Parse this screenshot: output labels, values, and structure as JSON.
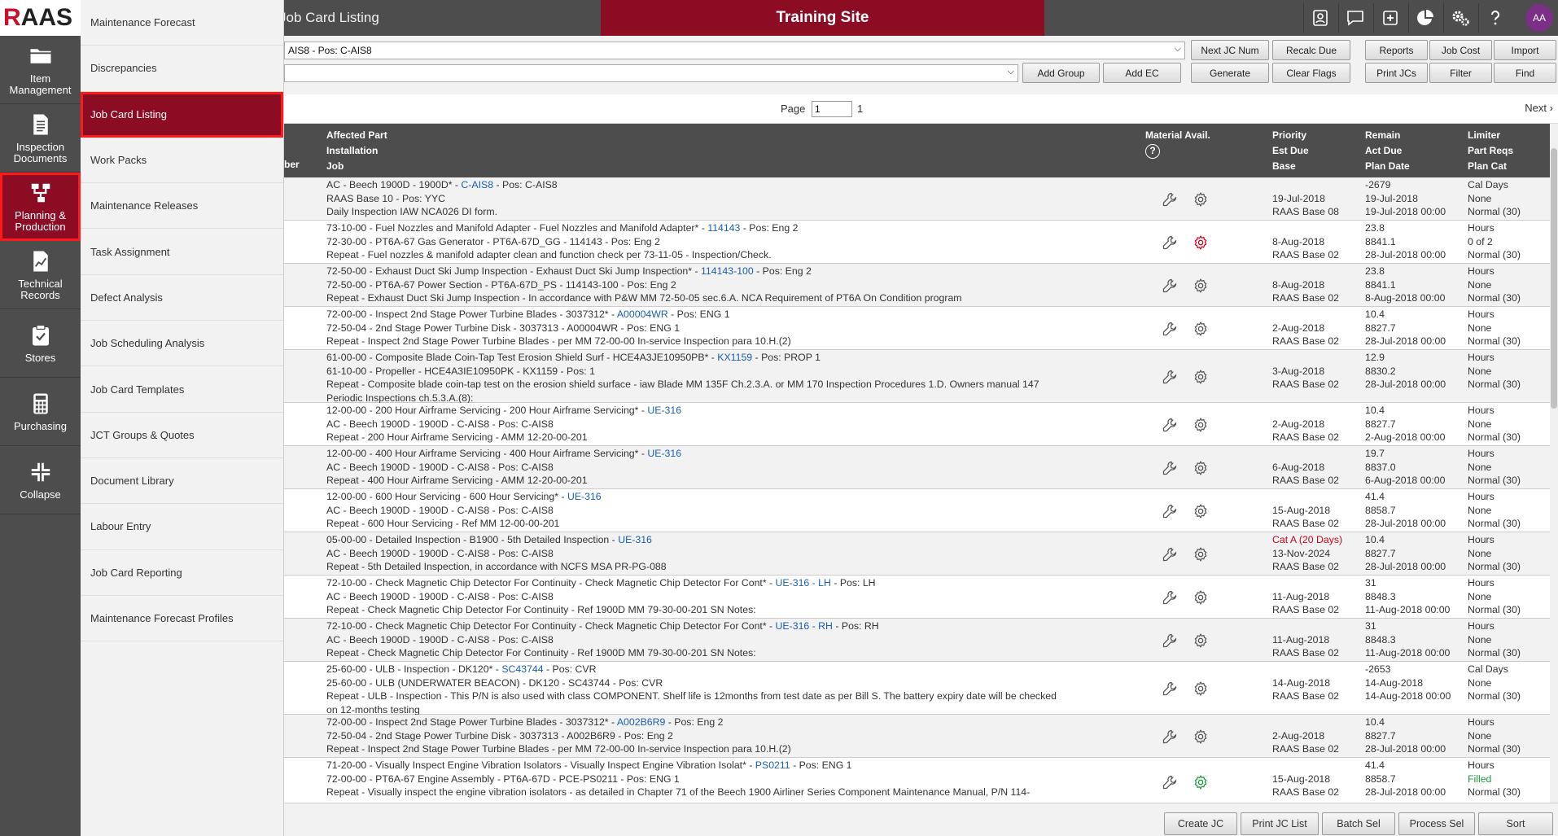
{
  "logo": {
    "text_r": "R",
    "text_rest": "AAS"
  },
  "rail": [
    {
      "label": "Item Management",
      "icon": "folder-icon"
    },
    {
      "label": "Inspection Documents",
      "icon": "document-icon"
    },
    {
      "label": "Planning & Production",
      "icon": "flow-icon",
      "active": true
    },
    {
      "label": "Technical Records",
      "icon": "chart-document-icon"
    },
    {
      "label": "Stores",
      "icon": "clipboard-check-icon"
    },
    {
      "label": "Purchasing",
      "icon": "calculator-icon"
    },
    {
      "label": "Collapse",
      "icon": "collapse-icon"
    }
  ],
  "menu": [
    {
      "label": "Maintenance Forecast"
    },
    {
      "label": "Discrepancies"
    },
    {
      "label": "Job Card Listing",
      "active": true
    },
    {
      "label": "Work Packs"
    },
    {
      "label": "Maintenance Releases"
    },
    {
      "label": "Task Assignment"
    },
    {
      "label": "Defect Analysis"
    },
    {
      "label": "Job Scheduling Analysis"
    },
    {
      "label": "Job Card Templates"
    },
    {
      "label": "JCT Groups & Quotes"
    },
    {
      "label": "Document Library"
    },
    {
      "label": "Labour Entry"
    },
    {
      "label": "Job Card Reporting"
    },
    {
      "label": "Maintenance Forecast Profiles"
    }
  ],
  "header": {
    "title": "Job Card Listing",
    "site_banner": "Training Site",
    "avatar": "AA",
    "icons": [
      "id-card-icon",
      "chat-icon",
      "plus-square-icon",
      "pie-chart-icon",
      "gears-icon",
      "help-icon"
    ]
  },
  "toolbar": {
    "aircraft_select": "AIS8 - Pos: C-AIS8",
    "group_select": "",
    "buttons": {
      "next_jc_num": "Next JC Num",
      "recalc_due": "Recalc Due",
      "reports": "Reports",
      "job_cost": "Job Cost",
      "import": "Import",
      "add_group": "Add Group",
      "add_ec": "Add EC",
      "generate": "Generate",
      "clear_flags": "Clear Flags",
      "print_jcs": "Print JCs",
      "filter": "Filter",
      "find": "Find"
    }
  },
  "pager": {
    "label": "Page",
    "value": "1",
    "total": "1",
    "next": "Next"
  },
  "columns": {
    "number_fragment": "ber",
    "desc": [
      "Affected Part",
      "Installation",
      "Job"
    ],
    "material": "Material Avail.",
    "priority": [
      "Priority",
      "Est Due",
      "Base"
    ],
    "remain": [
      "Remain",
      "Act Due",
      "Plan Date"
    ],
    "limiter": [
      "Limiter",
      "Part Reqs",
      "Plan Cat"
    ]
  },
  "rows": [
    {
      "l1": "AC - Beech 1900D - 1900D* - ",
      "l1_link": "C-AIS8",
      "l1_tail": " - Pos: C-AIS8",
      "l2": "RAAS Base 10 - Pos: YYC",
      "l3": "Daily Inspection IAW NCA026 DI form.",
      "l4": "",
      "gear": "normal",
      "p1": "",
      "p2": "19-Jul-2018",
      "p3": "RAAS Base 08",
      "r1": "-2679",
      "r2": "19-Jul-2018",
      "r3": "19-Jul-2018 00:00",
      "m1": "Cal Days",
      "m2": "None",
      "m3": "Normal (30)"
    },
    {
      "l1": "73-10-00 - Fuel Nozzles and Manifold Adapter - Fuel Nozzles and Manifold Adapter* - ",
      "l1_link": "114143",
      "l1_tail": " - Pos: Eng 2",
      "l2": "72-30-00 - PT6A-67 Gas Generator - PT6A-67D_GG - 114143 - Pos: Eng 2",
      "l3": "Repeat - Fuel nozzles & manifold adapter clean and function check per 73-11-05 - Inspection/Check.",
      "l4": "",
      "gear": "red",
      "p1": "",
      "p2": "8-Aug-2018",
      "p3": "RAAS Base 02",
      "r1": "23.8",
      "r2": "8841.1",
      "r3": "28-Jul-2018 00:00",
      "m1": "Hours",
      "m2": "0 of 2",
      "m3": "Normal (30)"
    },
    {
      "l1": "72-50-00 - Exhaust Duct Ski Jump Inspection - Exhaust Duct Ski Jump Inspection* - ",
      "l1_link": "114143-100",
      "l1_tail": " - Pos: Eng 2",
      "l2": "72-50-00 - PT6A-67 Power Section - PT6A-67D_PS - 114143-100 - Pos: Eng 2",
      "l3": "Repeat - Exhaust Duct Ski Jump Inspection - In accordance with P&W MM 72-50-05 sec.6.A. NCA Requirement of PT6A On Condition program",
      "l4": "",
      "gear": "normal",
      "p1": "",
      "p2": "8-Aug-2018",
      "p3": "RAAS Base 02",
      "r1": "23.8",
      "r2": "8841.1",
      "r3": "8-Aug-2018 00:00",
      "m1": "Hours",
      "m2": "None",
      "m3": "Normal (30)"
    },
    {
      "l1": "72-00-00 - Inspect 2nd Stage Power Turbine Blades - 3037312* - ",
      "l1_link": "A00004WR",
      "l1_tail": " - Pos: ENG 1",
      "l2": "72-50-04 - 2nd Stage Power Turbine Disk - 3037313 - A00004WR - Pos: ENG 1",
      "l3": "Repeat - Inspect 2nd Stage Power Turbine Blades - per MM 72-00-00 In-service Inspection para 10.H.(2)",
      "l4": "",
      "gear": "normal",
      "p1": "",
      "p2": "2-Aug-2018",
      "p3": "RAAS Base 02",
      "r1": "10.4",
      "r2": "8827.7",
      "r3": "28-Jul-2018 00:00",
      "m1": "Hours",
      "m2": "None",
      "m3": "Normal (30)"
    },
    {
      "l1": "61-00-00 - Composite Blade Coin-Tap Test Erosion Shield Surf - HCE4A3JE10950PB* - ",
      "l1_link": "KX1159",
      "l1_tail": " - Pos: PROP 1",
      "l2": "61-10-00 - Propeller - HCE4A3IE10950PK - KX1159 - Pos: 1",
      "l3": "Repeat - Composite blade coin-tap test on the erosion shield surface - iaw Blade MM 135F Ch.2.3.A. or MM 170 Inspection Procedures 1.D. Owners manual 147",
      "l4": "Periodic Inspections ch.5.3.A.(8):",
      "gear": "normal",
      "p1": "",
      "p2": "3-Aug-2018",
      "p3": "RAAS Base 02",
      "r1": "12.9",
      "r2": "8830.2",
      "r3": "28-Jul-2018 00:00",
      "m1": "Hours",
      "m2": "None",
      "m3": "Normal (30)"
    },
    {
      "l1": "12-00-00 - 200 Hour Airframe Servicing - 200 Hour Airframe Servicing* - ",
      "l1_link": "UE-316",
      "l1_tail": "",
      "l2": "AC - Beech 1900D - 1900D - C-AIS8 - Pos: C-AIS8",
      "l3": "Repeat - 200 Hour Airframe Servicing - AMM 12-20-00-201",
      "l4": "",
      "gear": "normal",
      "p1": "",
      "p2": "2-Aug-2018",
      "p3": "RAAS Base 02",
      "r1": "10.4",
      "r2": "8827.7",
      "r3": "2-Aug-2018 00:00",
      "m1": "Hours",
      "m2": "None",
      "m3": "Normal (30)"
    },
    {
      "l1": "12-00-00 - 400 Hour Airframe Servicing - 400 Hour Airframe Servicing* - ",
      "l1_link": "UE-316",
      "l1_tail": "",
      "l2": "AC - Beech 1900D - 1900D - C-AIS8 - Pos: C-AIS8",
      "l3": "Repeat - 400 Hour Airframe Servicing - AMM 12-20-00-201",
      "l4": "",
      "gear": "normal",
      "p1": "",
      "p2": "6-Aug-2018",
      "p3": "RAAS Base 02",
      "r1": "19.7",
      "r2": "8837.0",
      "r3": "6-Aug-2018 00:00",
      "m1": "Hours",
      "m2": "None",
      "m3": "Normal (30)"
    },
    {
      "l1": "12-00-00 - 600 Hour Servicing - 600 Hour Servicing* - ",
      "l1_link": "UE-316",
      "l1_tail": "",
      "l2": "AC - Beech 1900D - 1900D - C-AIS8 - Pos: C-AIS8",
      "l3": "Repeat - 600 Hour Servicing - Ref MM 12-00-00-201",
      "l4": "",
      "gear": "normal",
      "p1": "",
      "p2": "15-Aug-2018",
      "p3": "RAAS Base 02",
      "r1": "41.4",
      "r2": "8858.7",
      "r3": "28-Jul-2018 00:00",
      "m1": "Hours",
      "m2": "None",
      "m3": "Normal (30)"
    },
    {
      "l1": "05-00-00 - Detailed Inspection - B1900 - 5th Detailed Inspection - ",
      "l1_link": "UE-316",
      "l1_tail": "",
      "l2": "AC - Beech 1900D - 1900D - C-AIS8 - Pos: C-AIS8",
      "l3": "Repeat - 5th Detailed Inspection, in accordance with NCFS MSA PR-PG-088",
      "l4": "",
      "gear": "normal",
      "p1": "Cat A (20 Days)",
      "p2": "13-Nov-2024",
      "p3": "RAAS Base 02",
      "r1": "10.4",
      "r2": "8827.7",
      "r3": "28-Jul-2018 00:00",
      "m1": "Hours",
      "m2": "None",
      "m3": "Normal (30)"
    },
    {
      "l1": "72-10-00 - Check Magnetic Chip Detector For Continuity - Check Magnetic Chip Detector For Cont* - ",
      "l1_link": "UE-316 - LH",
      "l1_tail": " - Pos: LH",
      "l2": "AC - Beech 1900D - 1900D - C-AIS8 - Pos: C-AIS8",
      "l3": "Repeat - Check Magnetic Chip Detector For Continuity - Ref 1900D MM 79-30-00-201 SN Notes:",
      "l4": "",
      "gear": "normal",
      "p1": "",
      "p2": "11-Aug-2018",
      "p3": "RAAS Base 02",
      "r1": "31",
      "r2": "8848.3",
      "r3": "11-Aug-2018 00:00",
      "m1": "Hours",
      "m2": "None",
      "m3": "Normal (30)"
    },
    {
      "l1": "72-10-00 - Check Magnetic Chip Detector For Continuity - Check Magnetic Chip Detector For Cont* - ",
      "l1_link": "UE-316 - RH",
      "l1_tail": " - Pos: RH",
      "l2": "AC - Beech 1900D - 1900D - C-AIS8 - Pos: C-AIS8",
      "l3": "Repeat - Check Magnetic Chip Detector For Continuity - Ref 1900D MM 79-30-00-201 SN Notes:",
      "l4": "",
      "gear": "normal",
      "p1": "",
      "p2": "11-Aug-2018",
      "p3": "RAAS Base 02",
      "r1": "31",
      "r2": "8848.3",
      "r3": "11-Aug-2018 00:00",
      "m1": "Hours",
      "m2": "None",
      "m3": "Normal (30)"
    },
    {
      "l1": "25-60-00 - ULB - Inspection - DK120* - ",
      "l1_link": "SC43744",
      "l1_tail": " - Pos: CVR",
      "l2": "25-60-00 - ULB (UNDERWATER BEACON) - DK120 - SC43744 - Pos: CVR",
      "l3": "Repeat - ULB - Inspection - This P/N is also used with class COMPONENT. Shelf life is 12months from test date as per Bill S. The battery expiry date will be checked",
      "l4": "on 12-months testing",
      "gear": "normal",
      "p1": "",
      "p2": "14-Aug-2018",
      "p3": "RAAS Base 02",
      "r1": "-2653",
      "r2": "14-Aug-2018",
      "r3": "14-Aug-2018 00:00",
      "m1": "Cal Days",
      "m2": "None",
      "m3": "Normal (30)"
    },
    {
      "l1": "72-00-00 - Inspect 2nd Stage Power Turbine Blades - 3037312* - ",
      "l1_link": "A002B6R9",
      "l1_tail": " - Pos: Eng 2",
      "l2": "72-50-04 - 2nd Stage Power Turbine Disk - 3037313 - A002B6R9 - Pos: Eng 2",
      "l3": "Repeat - Inspect 2nd Stage Power Turbine Blades - per MM 72-00-00 In-service Inspection para 10.H.(2)",
      "l4": "",
      "gear": "normal",
      "p1": "",
      "p2": "2-Aug-2018",
      "p3": "RAAS Base 02",
      "r1": "10.4",
      "r2": "8827.7",
      "r3": "28-Jul-2018 00:00",
      "m1": "Hours",
      "m2": "None",
      "m3": "Normal (30)"
    },
    {
      "l1": "71-20-00 - Visually Inspect Engine Vibration Isolators - Visually Inspect Engine Vibration Isolat* - ",
      "l1_link": "PS0211",
      "l1_tail": " - Pos: ENG 1",
      "l2": "72-00-00 - PT6A-67 Engine Assembly - PT6A-67D - PCE-PS0211 - Pos: ENG 1",
      "l3": "Repeat - Visually inspect the engine vibration isolators - as detailed in Chapter 71 of the Beech 1900 Airliner Series Component Maintenance Manual, P/N 114-",
      "l4": "",
      "gear": "green",
      "p1": "",
      "p2": "15-Aug-2018",
      "p3": "RAAS Base 02",
      "r1": "41.4",
      "r2": "8858.7",
      "r3": "28-Jul-2018 00:00",
      "m1": "Hours",
      "m2": "Filled",
      "m3": "Normal (30)"
    }
  ],
  "footer": {
    "create_jc": "Create JC",
    "print_jc_list": "Print JC List",
    "batch_sel": "Batch Sel",
    "process_sel": "Process Sel",
    "sort": "Sort"
  },
  "colors": {
    "brand": "#8c0c24",
    "rail": "#4d4d4d",
    "link": "#1a5fb4",
    "alert": "#d0021b",
    "ok": "#1d9a3a"
  }
}
